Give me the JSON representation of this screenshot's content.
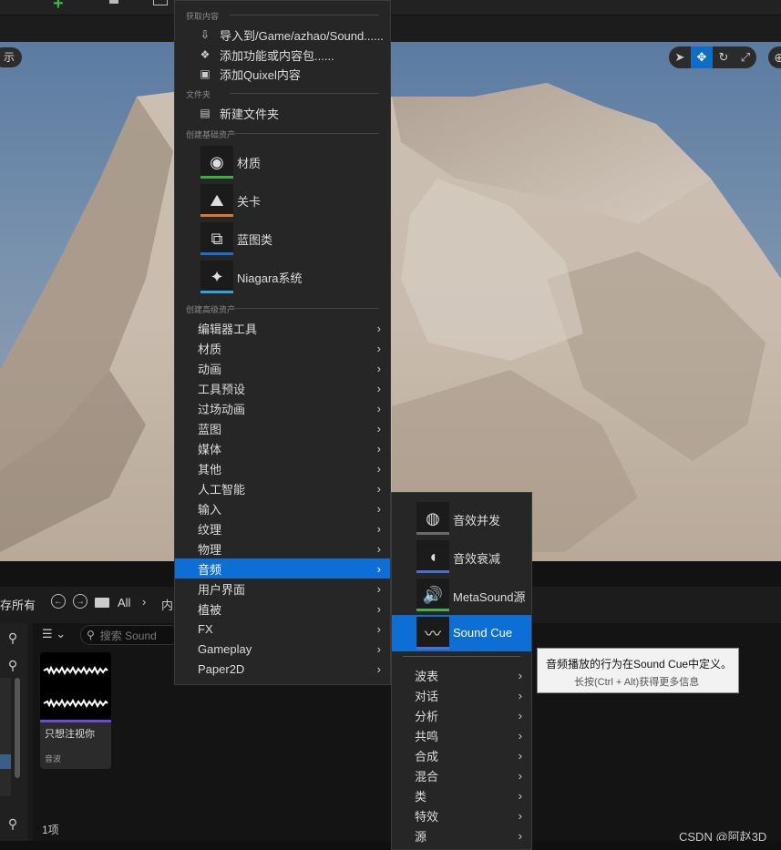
{
  "viewport": {
    "left_button_label": "示",
    "tools": [
      "select-icon",
      "move-icon",
      "rotate-icon",
      "scale-icon"
    ]
  },
  "content_browser": {
    "save_all": "存所有",
    "path_all": "All",
    "path_next": "内",
    "search_placeholder": "搜索 Sound",
    "asset": {
      "name": "只想注视你",
      "type": "音波"
    },
    "item_count": "1项"
  },
  "context_menu": {
    "sections": {
      "get_content": "获取内容",
      "folder": "文件夹",
      "basic_assets": "创建基础资产",
      "advanced_assets": "创建高级资产"
    },
    "get_content_items": [
      {
        "label": "导入到/Game/azhao/Sound......",
        "icon": "import-icon"
      },
      {
        "label": "添加功能或内容包......",
        "icon": "add-feature-icon"
      },
      {
        "label": "添加Quixel内容",
        "icon": "quixel-icon"
      }
    ],
    "folder_items": [
      {
        "label": "新建文件夹",
        "icon": "new-folder-icon"
      }
    ],
    "basic_assets": [
      {
        "label": "材质",
        "icon": "material-icon",
        "color": "#3cae3c"
      },
      {
        "label": "关卡",
        "icon": "level-icon",
        "color": "#e07b1a"
      },
      {
        "label": "蓝图类",
        "icon": "blueprint-icon",
        "color": "#1f6ed4"
      },
      {
        "label": "Niagara系统",
        "icon": "niagara-icon",
        "color": "#2ca6d9"
      }
    ],
    "advanced_assets": [
      "编辑器工具",
      "材质",
      "动画",
      "工具预设",
      "过场动画",
      "蓝图",
      "媒体",
      "其他",
      "人工智能",
      "输入",
      "纹理",
      "物理",
      "音频",
      "用户界面",
      "植被",
      "FX",
      "Gameplay",
      "Paper2D"
    ],
    "highlighted": "音频"
  },
  "audio_submenu": {
    "assets": [
      {
        "label": "音效并发",
        "icon": "sound-concurrency-icon",
        "color": "#6a6a6a"
      },
      {
        "label": "音效衰减",
        "icon": "sound-attenuation-icon",
        "color": "#4a6fd0"
      },
      {
        "label": "MetaSound源",
        "icon": "metasound-icon",
        "color": "#44b04a"
      },
      {
        "label": "Sound Cue",
        "icon": "sound-cue-icon",
        "color": "#4a6fd0"
      }
    ],
    "highlighted": "Sound Cue",
    "categories": [
      "波表",
      "对话",
      "分析",
      "共鸣",
      "合成",
      "混合",
      "类",
      "特效",
      "源"
    ]
  },
  "tooltip": {
    "text": "音频播放的行为在Sound Cue中定义。",
    "hint": "长按(Ctrl + Alt)获得更多信息"
  },
  "watermark": "CSDN @阿赵3D"
}
